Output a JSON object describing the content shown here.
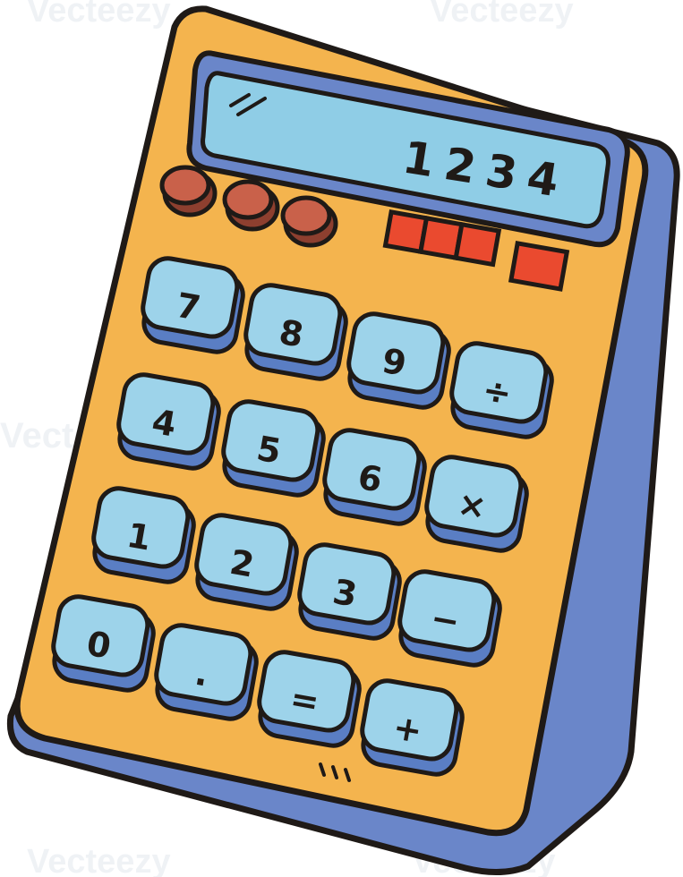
{
  "display": {
    "value": "1234"
  },
  "keys": [
    {
      "name": "key-7",
      "label": "7"
    },
    {
      "name": "key-8",
      "label": "8"
    },
    {
      "name": "key-9",
      "label": "9"
    },
    {
      "name": "key-divide",
      "label": "÷"
    },
    {
      "name": "key-4",
      "label": "4"
    },
    {
      "name": "key-5",
      "label": "5"
    },
    {
      "name": "key-6",
      "label": "6"
    },
    {
      "name": "key-multiply",
      "label": "×"
    },
    {
      "name": "key-1",
      "label": "1"
    },
    {
      "name": "key-2",
      "label": "2"
    },
    {
      "name": "key-3",
      "label": "3"
    },
    {
      "name": "key-minus",
      "label": "−"
    },
    {
      "name": "key-0",
      "label": "0"
    },
    {
      "name": "key-decimal",
      "label": "."
    },
    {
      "name": "key-equals",
      "label": "="
    },
    {
      "name": "key-plus",
      "label": "+"
    }
  ],
  "watermark": {
    "text": "Vecteezy"
  },
  "colors": {
    "body": "#f4b44e",
    "side": "#6a86c9",
    "screen": "#8fcde6",
    "key_face": "#9dd3ea",
    "key_side": "#5a7ec4",
    "round_button": "#c9614a",
    "indicator": "#ea4a2f",
    "outline": "#1f1a17"
  }
}
